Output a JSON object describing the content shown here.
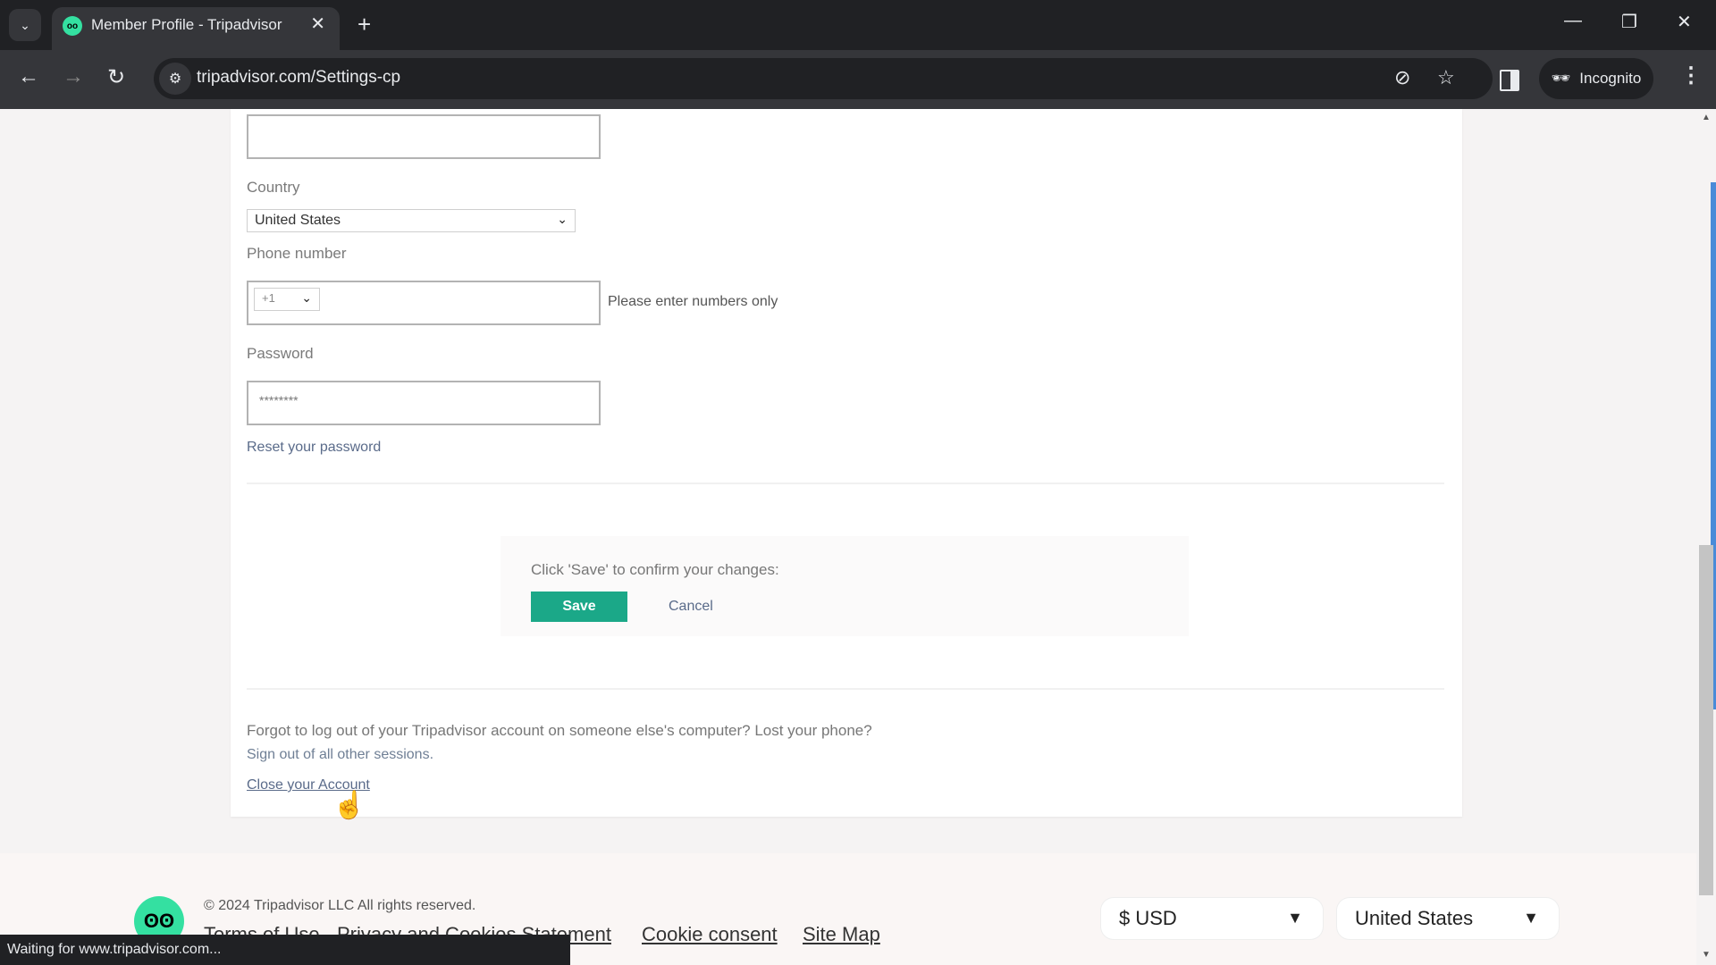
{
  "browser": {
    "tab_title": "Member Profile - Tripadvisor",
    "url": "tripadvisor.com/Settings-cp",
    "incognito_label": "Incognito",
    "status_text": "Waiting for www.tripadvisor.com..."
  },
  "form": {
    "top_field_value": "",
    "country_label": "Country",
    "country_value": "United States",
    "phone_label": "Phone number",
    "phone_code": "+1",
    "phone_value": "",
    "phone_hint": "Please enter numbers only",
    "password_label": "Password",
    "password_value": "********",
    "reset_password": "Reset your password"
  },
  "save_section": {
    "prompt": "Click 'Save' to confirm your changes:",
    "save_label": "Save",
    "cancel_label": "Cancel"
  },
  "sessions": {
    "text": "Forgot to log out of your Tripadvisor account on someone else's computer? Lost your phone?",
    "signout_link": "Sign out of all other sessions.",
    "close_account_link": "Close your Account"
  },
  "footer": {
    "copyright": "© 2024 Tripadvisor LLC All rights reserved.",
    "links": [
      "Terms of Use",
      "Privacy and Cookies Statement",
      "Cookie consent",
      "Site Map"
    ],
    "currency": "$ USD",
    "region": "United States"
  },
  "colors": {
    "brand_green": "#34e0a1",
    "save_button": "#1ba888"
  }
}
